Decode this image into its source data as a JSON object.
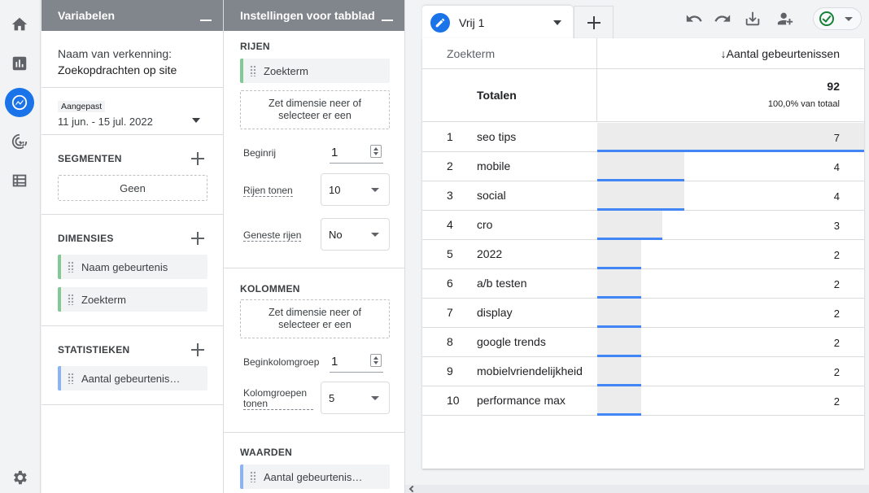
{
  "rail": {
    "icons": [
      "home-icon",
      "bar-chart-icon",
      "explore-icon",
      "target-icon",
      "list-icon",
      "gear-icon"
    ]
  },
  "variables": {
    "header": "Variabelen",
    "exploration_label": "Naam van verkenning:",
    "exploration_name": "Zoekopdrachten op site",
    "date_tag": "Aangepast",
    "date_range": "11 jun. - 15 jul. 2022",
    "segments_title": "SEGMENTEN",
    "segment_none": "Geen",
    "dimensions_title": "DIMENSIES",
    "dimensions": [
      "Naam gebeurtenis",
      "Zoekterm"
    ],
    "metrics_title": "STATISTIEKEN",
    "metrics": [
      "Aantal gebeurtenis…"
    ]
  },
  "settings": {
    "header": "Instellingen voor tabblad",
    "rows_title": "RIJEN",
    "rows_chip": "Zoekterm",
    "dropzone_text": "Zet dimensie neer of selecteer er een",
    "begin_row_label": "Beginrij",
    "begin_row_value": "1",
    "show_rows_label": "Rijen tonen",
    "show_rows_value": "10",
    "nested_rows_label": "Geneste rijen",
    "nested_rows_value": "No",
    "columns_title": "KOLOMMEN",
    "begin_col_group_label": "Beginkolomgroep",
    "begin_col_group_value": "1",
    "col_groups_label": "Kolomgroepen tonen",
    "col_groups_value": "5",
    "values_title": "WAARDEN",
    "values_chip": "Aantal gebeurtenis…"
  },
  "report": {
    "tab_name": "Vrij 1",
    "toolbar_icons": [
      "undo-icon",
      "redo-icon",
      "download-icon",
      "share-user-icon"
    ],
    "col_dim": "Zoekterm",
    "col_metric": "↓Aantal gebeurtenissen",
    "totals_label": "Totalen",
    "totals_value": "92",
    "totals_pct": "100,0% van totaal",
    "max_value": 7,
    "rows": [
      {
        "idx": "1",
        "term": "seo tips",
        "value": 7
      },
      {
        "idx": "2",
        "term": "mobile",
        "value": 4
      },
      {
        "idx": "3",
        "term": "social",
        "value": 4
      },
      {
        "idx": "4",
        "term": "cro",
        "value": 3
      },
      {
        "idx": "5",
        "term": "2022",
        "value": 2
      },
      {
        "idx": "6",
        "term": "a/b testen",
        "value": 2
      },
      {
        "idx": "7",
        "term": "display",
        "value": 2
      },
      {
        "idx": "8",
        "term": "google trends",
        "value": 2
      },
      {
        "idx": "9",
        "term": "mobielvriendelijkheid",
        "value": 2
      },
      {
        "idx": "10",
        "term": "performance max",
        "value": 2
      }
    ]
  }
}
